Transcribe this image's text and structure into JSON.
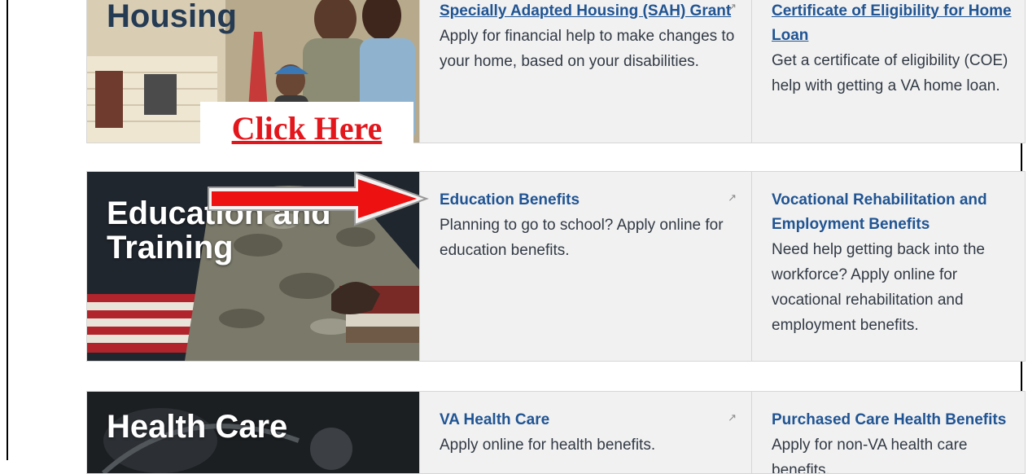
{
  "rows": [
    {
      "hero_title": "Housing",
      "cells": [
        {
          "title": "Specially Adapted Housing (SAH) Grant",
          "desc": "Apply for financial help to make changes to your home, based on your disabilities.",
          "icon": "external-link-icon"
        },
        {
          "title": "Certificate of Eligibility for Home Loan",
          "desc": "Get a certificate of eligibility (COE) help with getting a VA home loan."
        }
      ]
    },
    {
      "hero_title": "Education and Training",
      "cells": [
        {
          "title": "Education Benefits",
          "desc": "Planning to go to school? Apply online for education benefits.",
          "icon": "external-link-icon"
        },
        {
          "title": "Vocational Rehabilitation and Employment Benefits",
          "desc": "Need help getting back into the workforce? Apply online for vocational rehabilitation and employment benefits."
        }
      ]
    },
    {
      "hero_title": "Health Care",
      "cells": [
        {
          "title": "VA Health Care",
          "desc": "Apply online for health benefits.",
          "icon": "external-link-icon"
        },
        {
          "title": "Purchased Care Health Benefits",
          "desc": "Apply for non-VA health care benefits."
        }
      ]
    }
  ],
  "callout": {
    "text": "Click Here"
  },
  "colors": {
    "link": "#205493",
    "callout_red": "#e3161c",
    "arrow_red": "#ee1111"
  }
}
